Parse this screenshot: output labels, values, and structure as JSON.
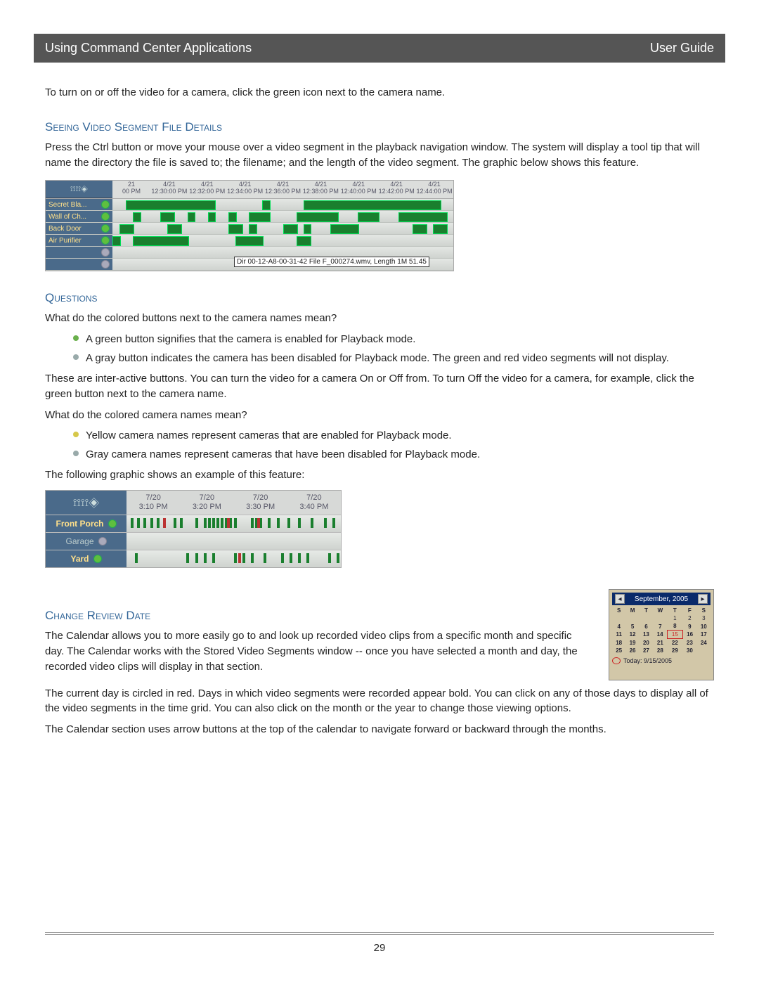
{
  "header": {
    "left": "Using Command Center Applications",
    "right": "User Guide"
  },
  "intro_line": "To turn on or off the video for a camera, click the green icon next to the camera name.",
  "section1": {
    "title": "Seeing Video Segment File Details",
    "para": "Press the Ctrl button or move your mouse over a video segment in the playback navigation window.  The system will display a tool tip that will name the directory the file is saved to; the filename; and the length of the video segment.  The graphic below shows this feature."
  },
  "timeline1": {
    "time_headers": [
      {
        "d": "21",
        "t": "00 PM"
      },
      {
        "d": "4/21",
        "t": "12:30:00 PM"
      },
      {
        "d": "4/21",
        "t": "12:32:00 PM"
      },
      {
        "d": "4/21",
        "t": "12:34:00 PM"
      },
      {
        "d": "4/21",
        "t": "12:36:00 PM"
      },
      {
        "d": "4/21",
        "t": "12:38:00 PM"
      },
      {
        "d": "4/21",
        "t": "12:40:00 PM"
      },
      {
        "d": "4/21",
        "t": "12:42:00 PM"
      },
      {
        "d": "4/21",
        "t": "12:44:00 PM"
      }
    ],
    "rows": [
      {
        "name": "Secret Bla...",
        "enabled": true
      },
      {
        "name": "Wall of Ch...",
        "enabled": true
      },
      {
        "name": "Back Door",
        "enabled": true
      },
      {
        "name": "Air Purifier",
        "enabled": true
      },
      {
        "name": "",
        "enabled": false
      },
      {
        "name": "",
        "enabled": false
      }
    ],
    "tooltip": "Dir 00-12-A8-00-31-42 File F_000274.wmv, Length 1M 51.45"
  },
  "questions": {
    "title": "Questions",
    "q1": "What do the colored buttons next to the camera names mean?",
    "a1": [
      "A green button signifies that the camera is enabled for Playback mode.",
      "A gray button indicates the camera has been disabled for Playback mode.  The green and red video segments will not display."
    ],
    "note1": "These are inter-active buttons.  You can turn the video for a camera On or Off from.  To turn Off the video for a camera, for example, click the green button next to the camera name.",
    "q2": "What do the colored camera names mean?",
    "a2": [
      "Yellow camera names represent cameras that are enabled for Playback mode.",
      "Gray camera names represent cameras that have been disabled for Playback mode."
    ],
    "note2": "The following graphic shows an example of this feature:"
  },
  "timeline2": {
    "headers": [
      {
        "d": "7/20",
        "t": "3:10 PM"
      },
      {
        "d": "7/20",
        "t": "3:20 PM"
      },
      {
        "d": "7/20",
        "t": "3:30 PM"
      },
      {
        "d": "7/20",
        "t": "3:40 PM"
      }
    ],
    "rows": [
      {
        "name": "Front Porch",
        "cls": "yellow",
        "enabled": true,
        "active": true
      },
      {
        "name": "Garage",
        "cls": "gray",
        "enabled": false,
        "active": false
      },
      {
        "name": "Yard",
        "cls": "yellow",
        "enabled": true,
        "active": true
      }
    ]
  },
  "change_date": {
    "title": "Change Review Date",
    "p1": "The Calendar allows you to more easily go to and look up recorded video clips from a specific month and specific day.  The Calendar works with the Stored Video Segments window -- once you have selected a month and day, the recorded video clips will display in that section.",
    "p2": "The current day is circled in red. Days in which video segments were recorded appear bold. You can click on any of those days to display all of the video segments in the time grid. You can also click on the month or the year to change those viewing options.",
    "p3": "The Calendar section uses arrow buttons at the top of the calendar to navigate forward or backward through the months."
  },
  "calendar": {
    "title": "September, 2005",
    "dow": [
      "Sun",
      "Mon",
      "Tue",
      "Wed",
      "Thu",
      "Fri",
      "Sat"
    ],
    "weeks": [
      [
        "",
        "",
        "",
        "",
        "1",
        "2",
        "3"
      ],
      [
        "4",
        "5",
        "6",
        "7",
        "8",
        "9",
        "10"
      ],
      [
        "11",
        "12",
        "13",
        "14",
        "15",
        "16",
        "17"
      ],
      [
        "18",
        "19",
        "20",
        "21",
        "22",
        "23",
        "24"
      ],
      [
        "25",
        "26",
        "27",
        "28",
        "29",
        "30",
        ""
      ]
    ],
    "bold_days": [
      "4",
      "5",
      "6",
      "7",
      "8",
      "9",
      "10",
      "11",
      "12",
      "13",
      "14",
      "16",
      "17",
      "18",
      "19",
      "20",
      "21",
      "22",
      "23",
      "24",
      "25",
      "26",
      "27",
      "28",
      "29",
      "30"
    ],
    "today": "15",
    "footer": "Today: 9/15/2005"
  },
  "page_number": "29"
}
